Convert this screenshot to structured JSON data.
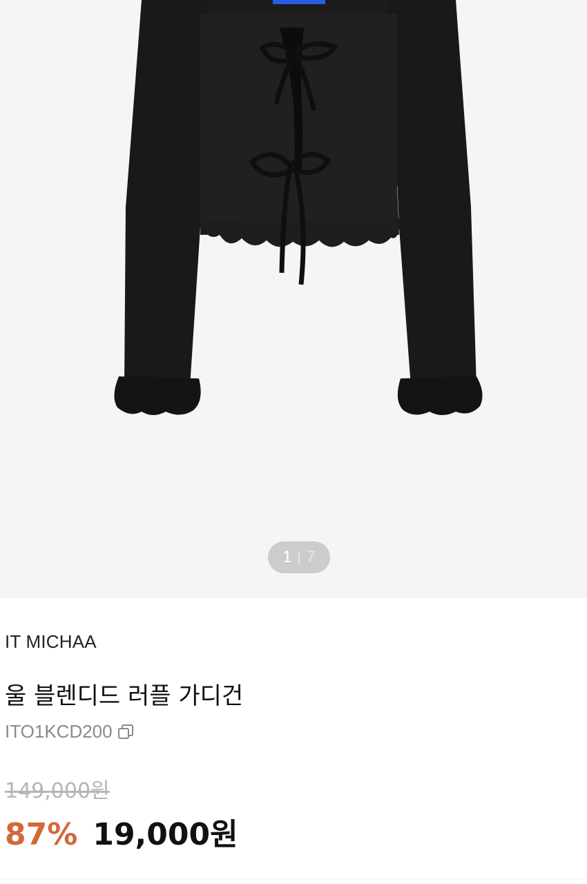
{
  "gallery": {
    "current": "1",
    "separator": "|",
    "total": "7",
    "image_icon": "cardigan-product-image"
  },
  "product": {
    "brand": "IT MICHAA",
    "title": "울 블렌디드 러플 가디건",
    "code": "ITO1KCD200",
    "copy_icon": "copy-icon",
    "original_price": "149,000원",
    "discount_rate": "87%",
    "sale_price": "19,000원"
  },
  "colors": {
    "gallery_bg": "#f5f5f5",
    "discount": "#d2693b",
    "garment": "#1a1a1a",
    "tag": "#2a5ce6"
  }
}
